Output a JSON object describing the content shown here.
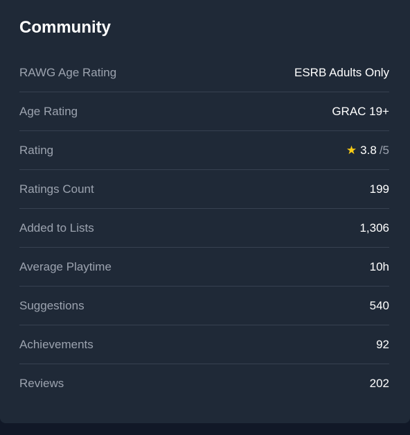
{
  "title": "Community",
  "rows": [
    {
      "label": "RAWG Age Rating",
      "value": "ESRB Adults Only"
    },
    {
      "label": "Age Rating",
      "value": "GRAC 19+"
    },
    {
      "label": "Rating",
      "value": "3.8",
      "suffix": "/5",
      "icon": "star-icon",
      "icon_color": "#facc15"
    },
    {
      "label": "Ratings Count",
      "value": "199"
    },
    {
      "label": "Added to Lists",
      "value": "1,306"
    },
    {
      "label": "Average Playtime",
      "value": "10h"
    },
    {
      "label": "Suggestions",
      "value": "540"
    },
    {
      "label": "Achievements",
      "value": "92"
    },
    {
      "label": "Reviews",
      "value": "202"
    }
  ]
}
